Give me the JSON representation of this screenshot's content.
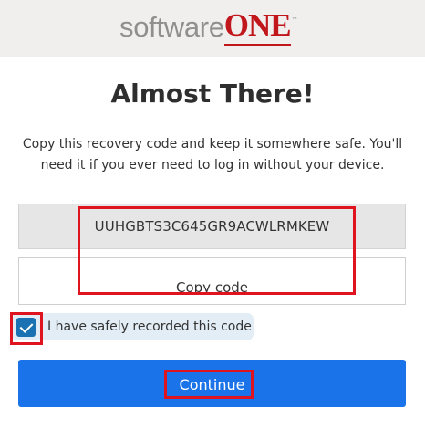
{
  "header": {
    "logo": {
      "part1": "software",
      "part2": "ONE",
      "trademark": "™"
    }
  },
  "page": {
    "title": "Almost There!",
    "description": "Copy this recovery code and keep it somewhere safe. You'll need it if you ever need to log in without your device."
  },
  "recovery": {
    "code": "UUHGBTS3C645GR9ACWLRMKEW",
    "copy_label": "Copy code"
  },
  "confirm": {
    "label": "I have safely recorded this code",
    "checked": true
  },
  "actions": {
    "continue_label": "Continue"
  },
  "colors": {
    "primary": "#1a73e8",
    "checkbox": "#1b72b2",
    "highlight": "#e0141e",
    "brand_red": "#c1161c",
    "header_bg": "#f0efee"
  }
}
